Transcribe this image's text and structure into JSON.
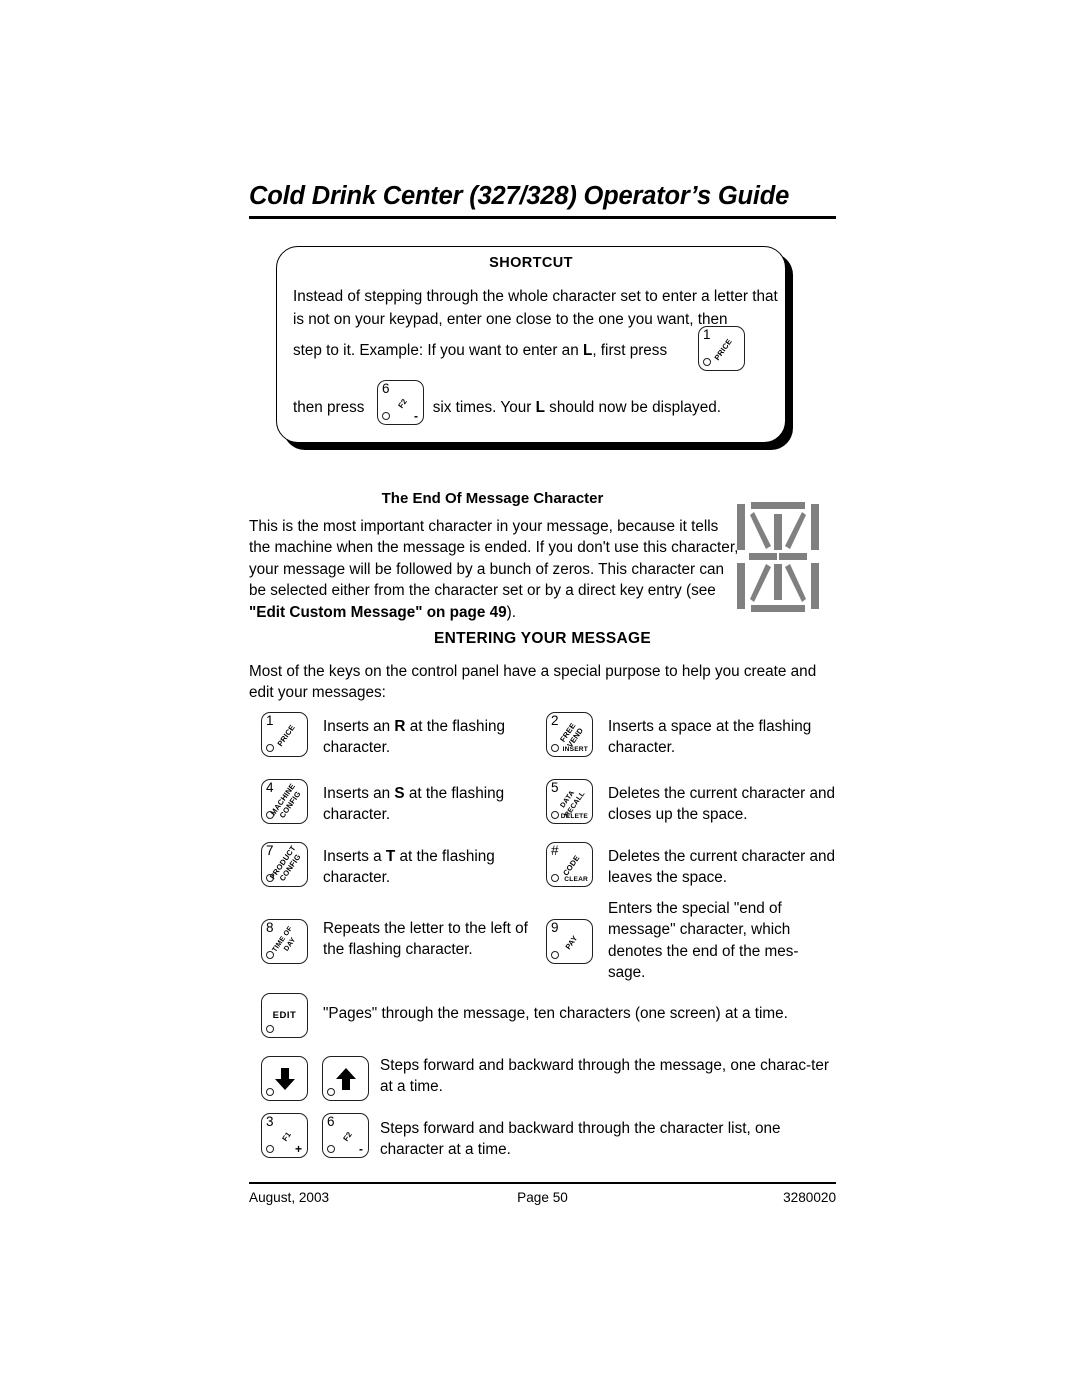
{
  "header": {
    "title": "Cold Drink Center (327/328) Operator’s Guide"
  },
  "shortcut": {
    "title": "SHORTCUT",
    "para1": "Instead of stepping through the whole character set to enter a letter that is not on your keypad, enter one close to the one you want, then",
    "line2_before": "step to it.  Example:  If you want to enter an ",
    "line2_bold": "L",
    "line2_after": ", first press",
    "line2_comma": ",",
    "line3_before": "then press",
    "line3_mid_a": "six times.  Your ",
    "line3_bold": "L",
    "line3_mid_b": " should now be displayed.",
    "key_price": {
      "num": "1",
      "diag": "PRICE",
      "sub": "",
      "sign": ""
    },
    "key_f2": {
      "num": "6",
      "diag": "F2",
      "sub": "",
      "sign": "-"
    }
  },
  "end_of_message": {
    "title": "The End Of Message Character",
    "body_1": "This is the most important character in your message, because it tells the machine when the message is ended.  If you don't use this character, your message will be followed by a bunch of zeros.  This character can be selected either from the character set or by a direct key entry (see ",
    "body_bold": "\"Edit Custom Message\" on page 49",
    "body_2": ").",
    "display_icon": "sixteen-segment-display-all-on",
    "display_color": "#808080"
  },
  "entering": {
    "title": "ENTERING YOUR MESSAGE",
    "intro": "Most of the keys on the control panel have a special purpose to help you create and edit your messages:"
  },
  "key_rows": [
    {
      "key": {
        "num": "1",
        "diag": "PRICE",
        "sub": "",
        "sign": ""
      },
      "text_parts": [
        "Inserts an ",
        "R",
        " at the flashing character."
      ]
    },
    {
      "key": {
        "num": "2",
        "diag": "FREE VEND",
        "sub": "INSERT",
        "sign": ""
      },
      "text_parts": [
        "Inserts a space at the flashing character.",
        "",
        ""
      ]
    },
    {
      "key": {
        "num": "4",
        "diag": "MACHINE\nCONFIG",
        "sub": "",
        "sign": ""
      },
      "text_parts": [
        "Inserts an ",
        "S",
        " at the flashing character."
      ]
    },
    {
      "key": {
        "num": "5",
        "diag": "DATA RECALL",
        "sub": "DELETE",
        "sign": ""
      },
      "text_parts": [
        "Deletes the current character and closes up the space.",
        "",
        ""
      ]
    },
    {
      "key": {
        "num": "7",
        "diag": "PRODUCT\nCONFIG",
        "sub": "",
        "sign": ""
      },
      "text_parts": [
        "Inserts a ",
        "T",
        " at the flashing character."
      ]
    },
    {
      "key": {
        "num": "#",
        "diag": "CODE",
        "sub": "CLEAR",
        "sign": ""
      },
      "text_parts": [
        "Deletes the current character and leaves the space.",
        "",
        ""
      ]
    },
    {
      "key": {
        "num": "8",
        "diag": "TIME OF DAY",
        "sub": "",
        "sign": ""
      },
      "text_parts": [
        "Repeats the letter to the left of the flashing character.",
        "",
        ""
      ]
    },
    {
      "key": {
        "num": "9",
        "diag": "PAY",
        "sub": "",
        "sign": ""
      },
      "text_parts": [
        "Enters the special \"end of message\" character, which denotes the end of the mes-sage.",
        "",
        ""
      ]
    }
  ],
  "labels": {
    "row1_left": "Inserts an R at the flashing character.",
    "row1_left_pre": "Inserts an ",
    "row1_left_bold": "R",
    "row1_left_post": " at the flashing character.",
    "row1_right": "Inserts a space at the flashing character.",
    "row2_left_pre": "Inserts an ",
    "row2_left_bold": "S",
    "row2_left_post": " at the flashing character.",
    "row2_right": "Deletes the current character and closes up the space.",
    "row3_left_pre": "Inserts a ",
    "row3_left_bold": "T",
    "row3_left_post": " at the flashing character.",
    "row3_right": "Deletes the current character and leaves the space.",
    "row4_left": "Repeats the letter to the left of the flashing character.",
    "row4_right": "Enters the special \"end of message\" character, which denotes the end of the mes-sage.",
    "edit_text": "\"Pages\" through the message, ten characters (one screen) at a time.",
    "arrows_text": "Steps forward and backward through the message, one charac-ter at  a time.",
    "f_keys_text": "Steps forward and backward through the character list, one character at  a time."
  },
  "keys": {
    "edit": {
      "num": "",
      "label": "EDIT"
    },
    "arrow_down": {
      "icon": "arrow-down-icon"
    },
    "arrow_up": {
      "icon": "arrow-up-icon"
    },
    "f1": {
      "num": "3",
      "diag": "F1",
      "sign": "+"
    },
    "f2": {
      "num": "6",
      "diag": "F2",
      "sign": "-"
    }
  },
  "footer": {
    "left": "August, 2003",
    "center": "Page 50",
    "right": "3280020"
  }
}
